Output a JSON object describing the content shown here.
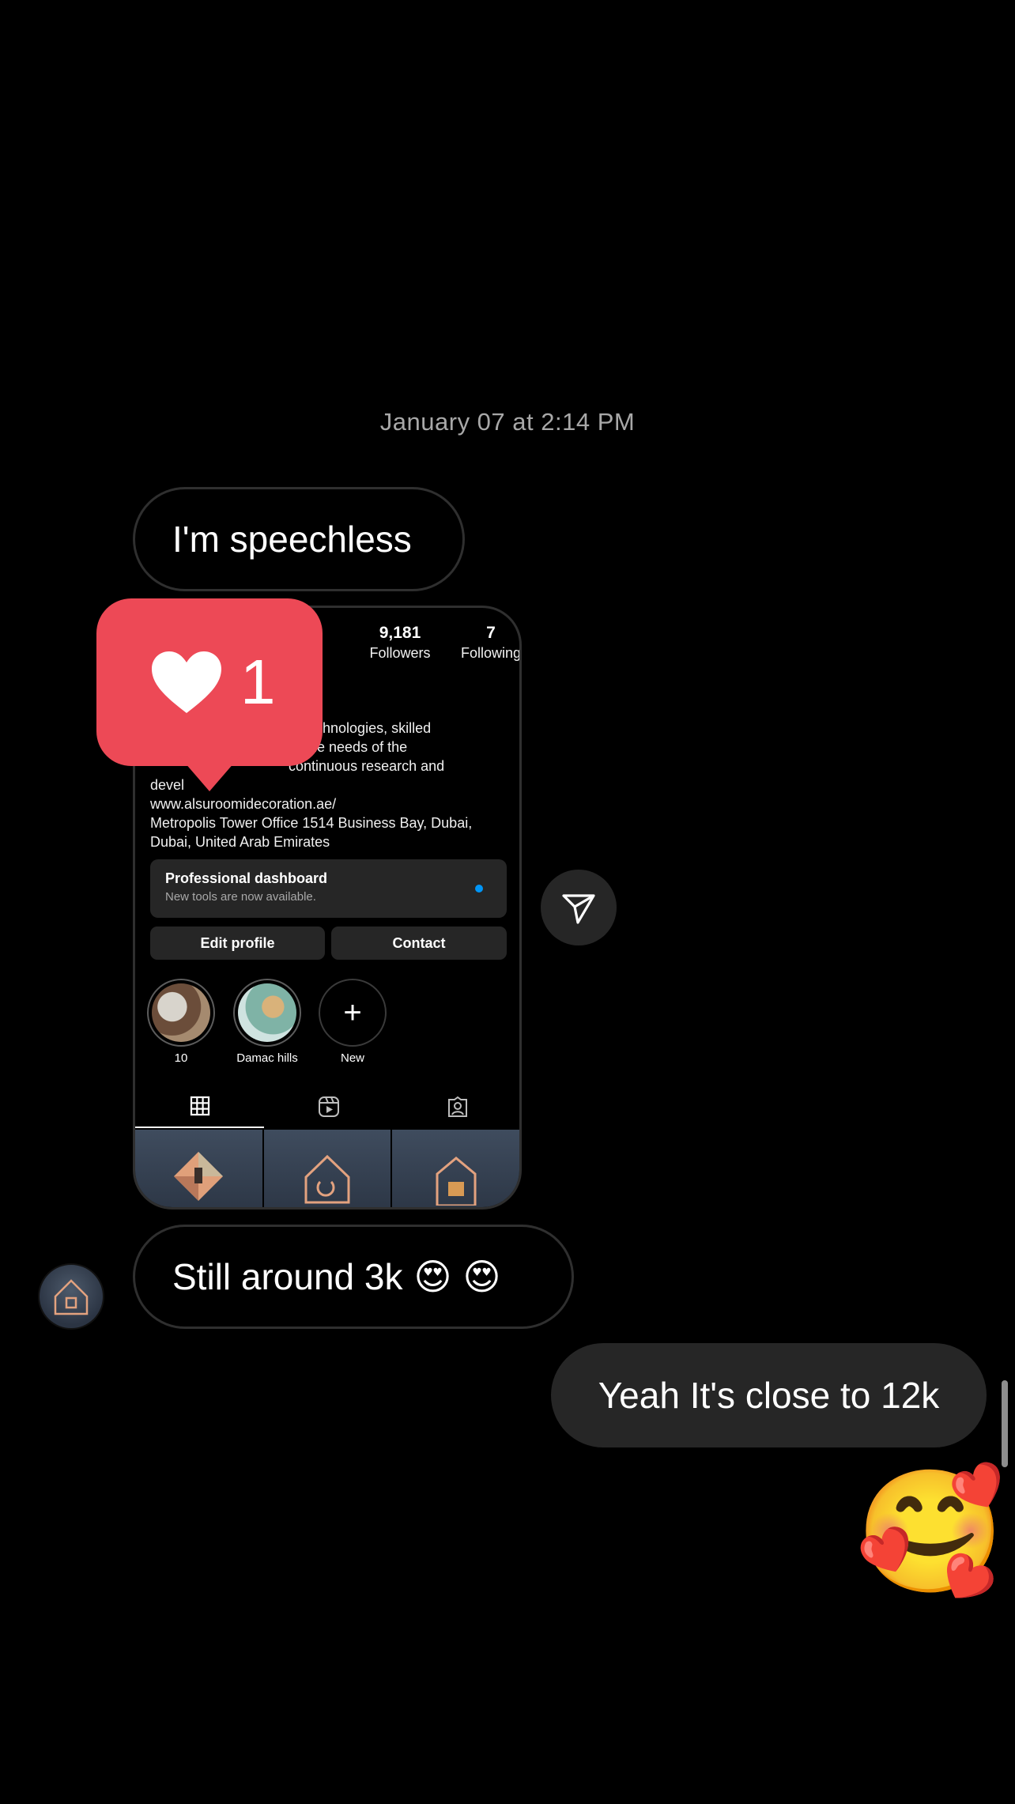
{
  "conversation": {
    "timestamp": "January 07 at 2:14 PM",
    "messages": {
      "speechless": "I'm speechless",
      "still_around": "Still around 3k",
      "still_around_emojis": [
        "😍",
        "😍"
      ],
      "close_to": "Yeah It's close to 12k",
      "reaction_emoji": "🥰"
    }
  },
  "shared_profile": {
    "stats": {
      "followers_count": "9,181",
      "followers_label": "Followers",
      "following_count": "7",
      "following_label": "Following"
    },
    "bio": {
      "line1": "st technologies, skilled",
      "line2": "or the needs of the",
      "line3": "continuous research and",
      "line4": "devel",
      "website": "www.alsuroomidecoration.ae/",
      "address1": "Metropolis Tower Office 1514 Business Bay, Dubai,",
      "address2": "Dubai, United Arab Emirates"
    },
    "dashboard": {
      "title": "Professional dashboard",
      "subtitle": "New tools are now available."
    },
    "buttons": {
      "edit": "Edit profile",
      "contact": "Contact"
    },
    "highlights": [
      {
        "label": "10"
      },
      {
        "label": "Damac hills"
      },
      {
        "label": "New",
        "icon": "plus-icon"
      }
    ],
    "tabs": [
      "grid-icon",
      "reels-icon",
      "tagged-icon"
    ]
  },
  "like_reaction": {
    "count": "1",
    "icon": "heart-icon",
    "color": "#ed4956"
  },
  "colors": {
    "background": "#000000",
    "my_bubble": "#262626",
    "timestamp": "#a8a8a8",
    "accent": "#0095f6"
  }
}
